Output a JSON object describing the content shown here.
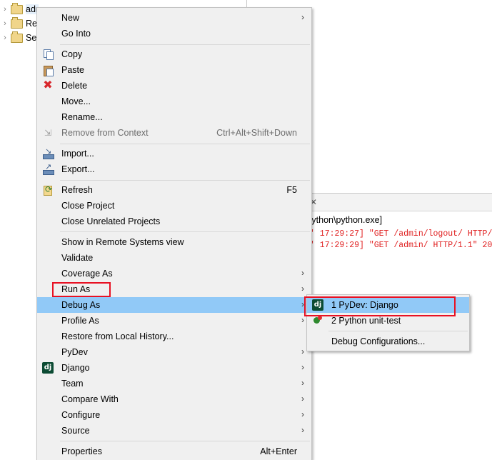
{
  "explorer": {
    "items": [
      {
        "label": "adr"
      },
      {
        "label": "Re"
      },
      {
        "label": "Se"
      }
    ]
  },
  "console": {
    "close_glyph": "✕",
    "path": "\\python\\python.exe]",
    "lines": [
      "' 17:29:27] \"GET /admin/logout/ HTTP/",
      "' 17:29:29] \"GET /admin/ HTTP/1.1\" 20"
    ]
  },
  "menu": {
    "new": "New",
    "go_into": "Go Into",
    "copy": "Copy",
    "paste": "Paste",
    "delete": "Delete",
    "move": "Move...",
    "rename": "Rename...",
    "remove_context": "Remove from Context",
    "remove_context_shortcut": "Ctrl+Alt+Shift+Down",
    "import": "Import...",
    "export": "Export...",
    "refresh": "Refresh",
    "refresh_shortcut": "F5",
    "close_project": "Close Project",
    "close_unrelated": "Close Unrelated Projects",
    "show_remote": "Show in Remote Systems view",
    "validate": "Validate",
    "coverage_as": "Coverage As",
    "run_as": "Run As",
    "debug_as": "Debug As",
    "profile_as": "Profile As",
    "restore_history": "Restore from Local History...",
    "pydev": "PyDev",
    "django": "Django",
    "team": "Team",
    "compare_with": "Compare With",
    "configure": "Configure",
    "source": "Source",
    "properties": "Properties",
    "properties_shortcut": "Alt+Enter",
    "arrow": "›",
    "dj_icon": "dj"
  },
  "submenu": {
    "pydev_django": "1 PyDev: Django",
    "python_unittest": "2 Python unit-test",
    "debug_configurations": "Debug Configurations..."
  },
  "colors": {
    "highlight": "#91c9f7",
    "annotation": "#e81123",
    "console_text": "#e02020"
  }
}
